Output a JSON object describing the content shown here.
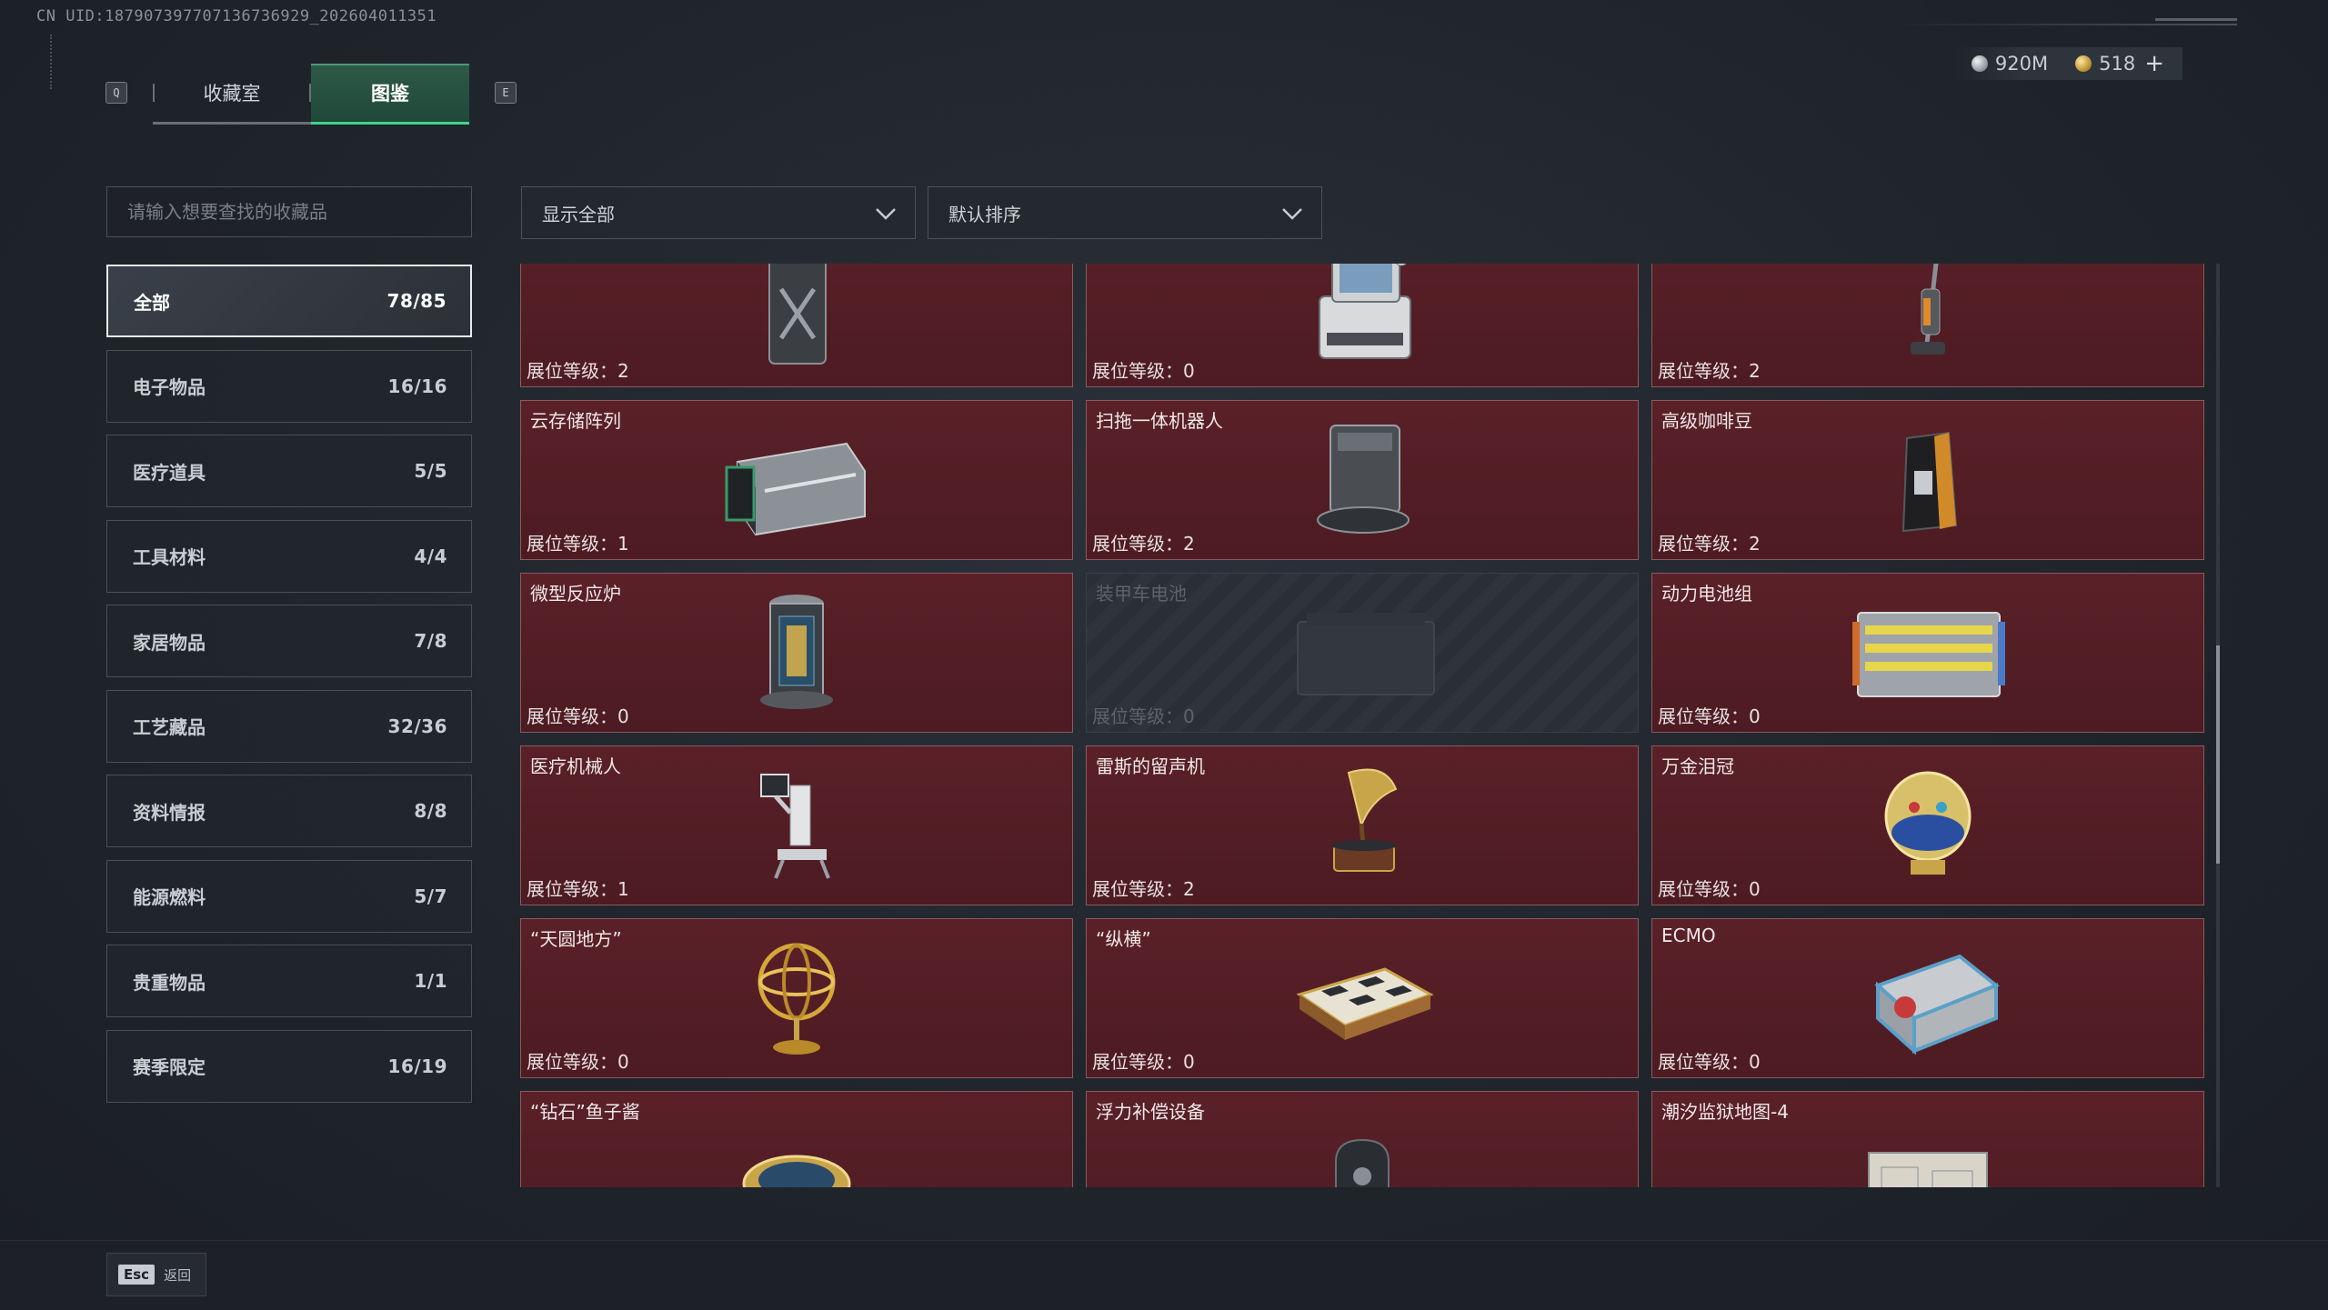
{
  "uid": "CN UID:1879073977071367369​29_202604011351",
  "tabs": {
    "prev_key": "Q",
    "next_key": "E",
    "items": [
      {
        "label": "收藏室",
        "active": false
      },
      {
        "label": "图鉴",
        "active": true
      }
    ]
  },
  "currency": {
    "silver": "920M",
    "gold": "518",
    "add": "+"
  },
  "search": {
    "placeholder": "请输入想要查找的收藏品"
  },
  "filter": {
    "value": "显示全部"
  },
  "sort": {
    "value": "默认排序"
  },
  "categories": [
    {
      "label": "全部",
      "count": "78/85"
    },
    {
      "label": "电子物品",
      "count": "16/16"
    },
    {
      "label": "医疗道具",
      "count": "5/5"
    },
    {
      "label": "工具材料",
      "count": "4/4"
    },
    {
      "label": "家居物品",
      "count": "7/8"
    },
    {
      "label": "工艺藏品",
      "count": "32/36"
    },
    {
      "label": "资料情报",
      "count": "8/8"
    },
    {
      "label": "能源燃料",
      "count": "5/7"
    },
    {
      "label": "贵重物品",
      "count": "1/1"
    },
    {
      "label": "赛季限定",
      "count": "16/19"
    }
  ],
  "items": [
    {
      "name": "",
      "level": "展位等级：2",
      "icon": "fuel-can-icon"
    },
    {
      "name": "",
      "level": "展位等级：0",
      "icon": "computer-terminal-icon"
    },
    {
      "name": "",
      "level": "展位等级：2",
      "icon": "floor-scrubber-icon"
    },
    {
      "name": "云存储阵列",
      "level": "展位等级：1",
      "icon": "storage-array-icon"
    },
    {
      "name": "扫拖一体机器人",
      "level": "展位等级：2",
      "icon": "robot-vacuum-icon"
    },
    {
      "name": "高级咖啡豆",
      "level": "展位等级：2",
      "icon": "coffee-bag-icon"
    },
    {
      "name": "微型反应炉",
      "level": "展位等级：0",
      "icon": "reactor-icon"
    },
    {
      "name": "装甲车电池",
      "level": "展位等级：0",
      "icon": "battery-box-icon",
      "locked": true
    },
    {
      "name": "动力电池组",
      "level": "展位等级：0",
      "icon": "battery-pack-icon"
    },
    {
      "name": "医疗机械人",
      "level": "展位等级：1",
      "icon": "medical-robot-icon"
    },
    {
      "name": "雷斯的留声机",
      "level": "展位等级：2",
      "icon": "gramophone-icon"
    },
    {
      "name": "万金泪冠",
      "level": "展位等级：0",
      "icon": "jeweled-egg-icon"
    },
    {
      "name": "“天圆地方”",
      "level": "展位等级：0",
      "icon": "armillary-sphere-icon"
    },
    {
      "name": "“纵横”",
      "level": "展位等级：0",
      "icon": "chessboard-icon"
    },
    {
      "name": "ECMO",
      "level": "展位等级：0",
      "icon": "ecmo-machine-icon"
    },
    {
      "name": "“钻石”鱼子酱",
      "level": "",
      "icon": "caviar-tin-icon"
    },
    {
      "name": "浮力补偿设备",
      "level": "",
      "icon": "buoyancy-device-icon"
    },
    {
      "name": "潮汐监狱地图-4",
      "level": "",
      "icon": "map-sheet-icon"
    }
  ],
  "footer": {
    "esc_key": "Esc",
    "back_label": "返回"
  }
}
